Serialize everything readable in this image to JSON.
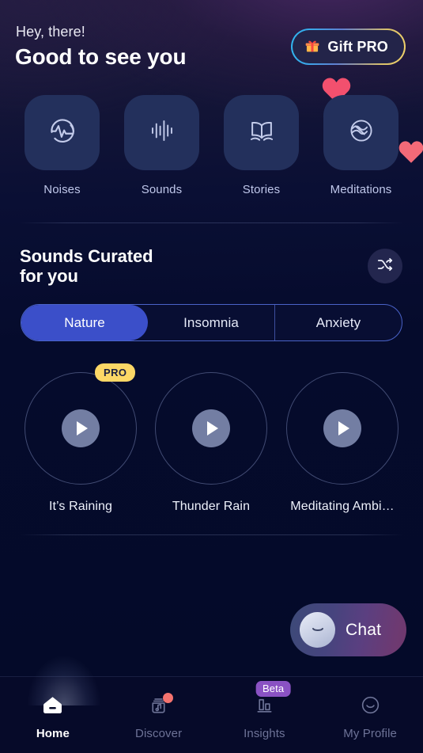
{
  "header": {
    "greeting_small": "Hey, there!",
    "greeting_large": "Good to see you",
    "gift_button_label": "Gift PRO",
    "gift_icon": "gift-icon"
  },
  "categories": [
    {
      "label": "Noises",
      "icon": "pulse-circle-icon"
    },
    {
      "label": "Sounds",
      "icon": "waveform-bars-icon"
    },
    {
      "label": "Stories",
      "icon": "open-book-icon"
    },
    {
      "label": "Meditations",
      "icon": "wave-circle-icon"
    }
  ],
  "curated": {
    "title_line1": "Sounds Curated",
    "title_line2": "for you",
    "shuffle_icon": "shuffle-icon",
    "tabs": [
      {
        "label": "Nature",
        "active": true
      },
      {
        "label": "Insomnia",
        "active": false
      },
      {
        "label": "Anxiety",
        "active": false
      }
    ],
    "sounds": [
      {
        "label": "It’s Raining",
        "badge": "PRO",
        "play_icon": "play-icon"
      },
      {
        "label": "Thunder Rain",
        "badge": "",
        "play_icon": "play-icon"
      },
      {
        "label": "Meditating Ambi…",
        "badge": "",
        "play_icon": "play-icon"
      }
    ]
  },
  "chat": {
    "label": "Chat",
    "avatar_icon": "chat-avatar-icon"
  },
  "navbar": [
    {
      "label": "Home",
      "icon": "home-icon",
      "active": true,
      "badge": "",
      "dot": false
    },
    {
      "label": "Discover",
      "icon": "music-box-icon",
      "active": false,
      "badge": "",
      "dot": true
    },
    {
      "label": "Insights",
      "icon": "bar-chart-icon",
      "active": false,
      "badge": "Beta",
      "dot": false
    },
    {
      "label": "My Profile",
      "icon": "smiley-icon",
      "active": false,
      "badge": "",
      "dot": false
    }
  ],
  "colors": {
    "background_top": "#1d1b3c",
    "background_bottom": "#040a28",
    "tile": "#23305c",
    "accent_blue": "#3b4fc9",
    "pro_yellow": "#fcd766",
    "beta_purple": "#8a52c3",
    "heart_pink": "#f2506e",
    "badge_dot": "#f4736f"
  }
}
